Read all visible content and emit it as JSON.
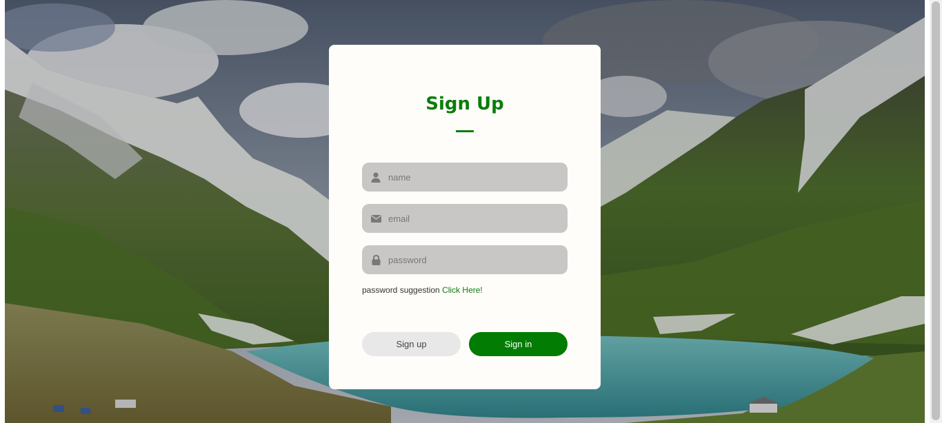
{
  "form": {
    "title": "Sign Up",
    "fields": [
      {
        "icon": "user-icon",
        "placeholder": "name",
        "value": ""
      },
      {
        "icon": "envelope-icon",
        "placeholder": "email",
        "value": ""
      },
      {
        "icon": "lock-icon",
        "placeholder": "password",
        "value": ""
      }
    ],
    "suggestion_text": "password suggestion",
    "suggestion_link": "Click Here!",
    "buttons": {
      "signup_label": "Sign up",
      "signin_label": "Sign in"
    }
  },
  "colors": {
    "accent": "#0a7d0a",
    "signin_bg": "#027c02",
    "signup_bg": "#e8e8e8",
    "field_bg": "#c9c6c6",
    "card_bg": "#fffdfa"
  }
}
